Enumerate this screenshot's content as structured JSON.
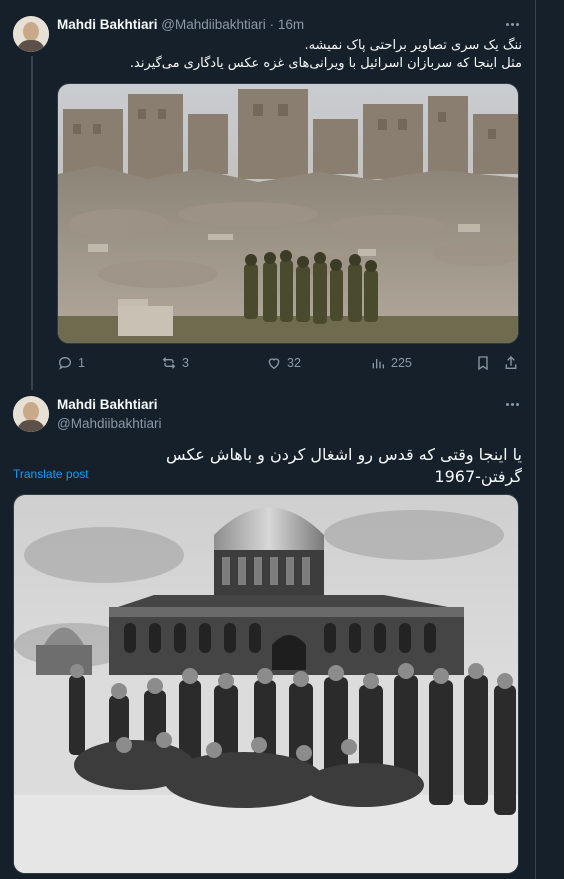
{
  "tweet1": {
    "author_name": "Mahdi Bakhtiari",
    "handle": "@Mahdiibakhtiari",
    "separator": "·",
    "time": "16m",
    "line1": "ننگ یک سری تصاویر براحتی پاک نمیشه.",
    "line2": "مثل اینجا که سربازان اسرائیل با ویرانی‌های غزه عکس یادگاری می‌گیرند.",
    "image_icon": "photo-of-soldiers-posing-in-rubble",
    "stats": {
      "replies": "1",
      "reposts": "3",
      "likes": "32",
      "views": "225"
    }
  },
  "tweet2": {
    "author_name": "Mahdi Bakhtiari",
    "handle": "@Mahdiibakhtiari",
    "text": "یا اینجا وقتی که قدس رو اشغال کردن و باهاش عکس گرفتن-1967",
    "translate_label": "Translate post",
    "image_icon": "black-and-white-photo-soldiers-in-front-of-dome"
  },
  "colors": {
    "background": "#15202b",
    "text": "#f7f9f9",
    "secondary": "#8b98a5",
    "link": "#1d9bf0",
    "border": "#38444d"
  }
}
